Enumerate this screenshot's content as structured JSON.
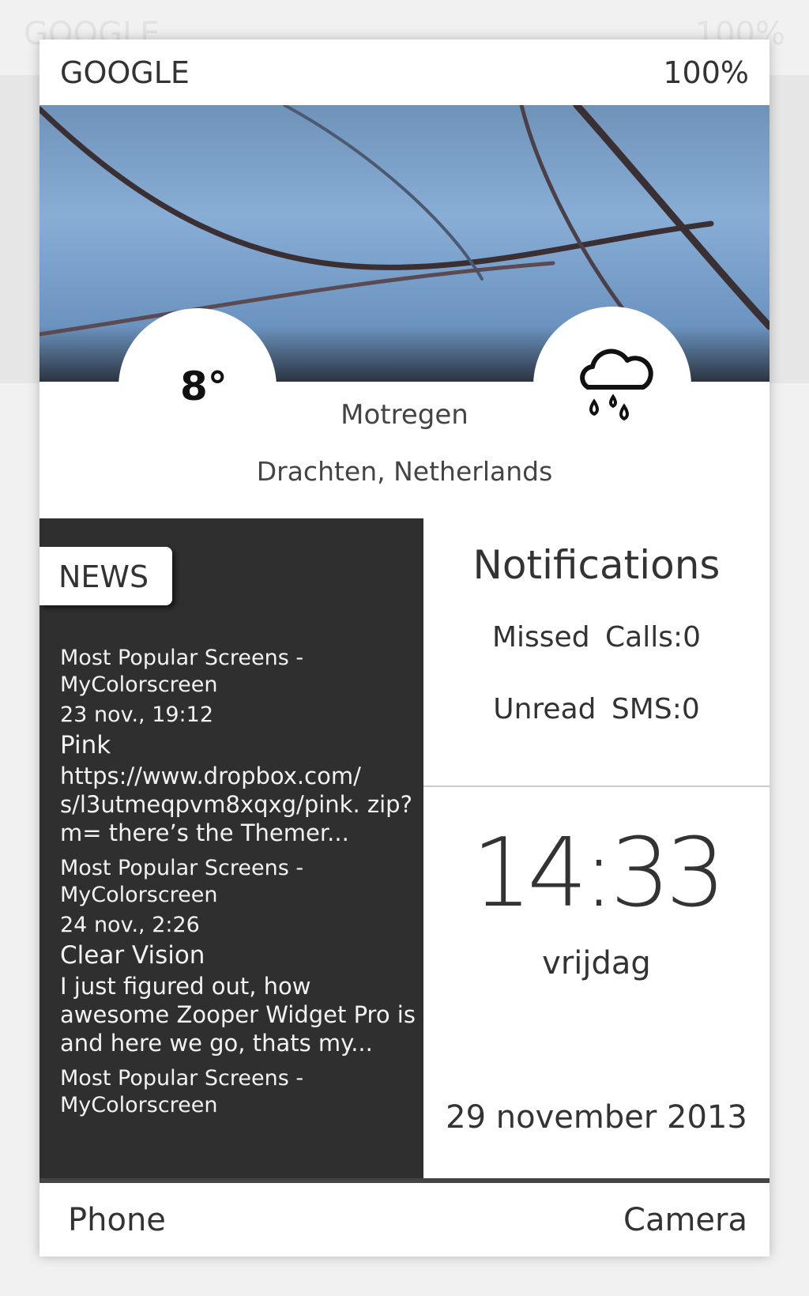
{
  "header": {
    "title": "GOOGLE",
    "battery": "100%"
  },
  "weather": {
    "temperature": "8°",
    "condition": "Motregen",
    "location": "Drachten, Netherlands",
    "icon": "cloud-rain-icon"
  },
  "news": {
    "tab_label": "NEWS",
    "items": [
      {
        "source": "Most Popular Screens - MyColorscreen",
        "date": "23 nov., 19:12",
        "title": "Pink",
        "body": "https://www.dropbox.com/ s/l3utmeqpvm8xqxg/pink. zip?m= there’s the Themer..."
      },
      {
        "source": "Most Popular Screens - MyColorscreen",
        "date": "24 nov., 2:26",
        "title": "Clear Vision",
        "body": "I just figured out, how awesome Zooper Widget Pro is and here we go, thats my..."
      },
      {
        "source": "Most Popular Screens - MyColorscreen"
      }
    ]
  },
  "notifications": {
    "title": "Notifications",
    "missed_calls": "Missed  Calls:0",
    "unread_sms": "Unread  SMS:0"
  },
  "clock": {
    "time": "14:33",
    "day": "vrijdag",
    "date": "29 november 2013"
  },
  "footer": {
    "left": "Phone",
    "right": "Camera"
  }
}
